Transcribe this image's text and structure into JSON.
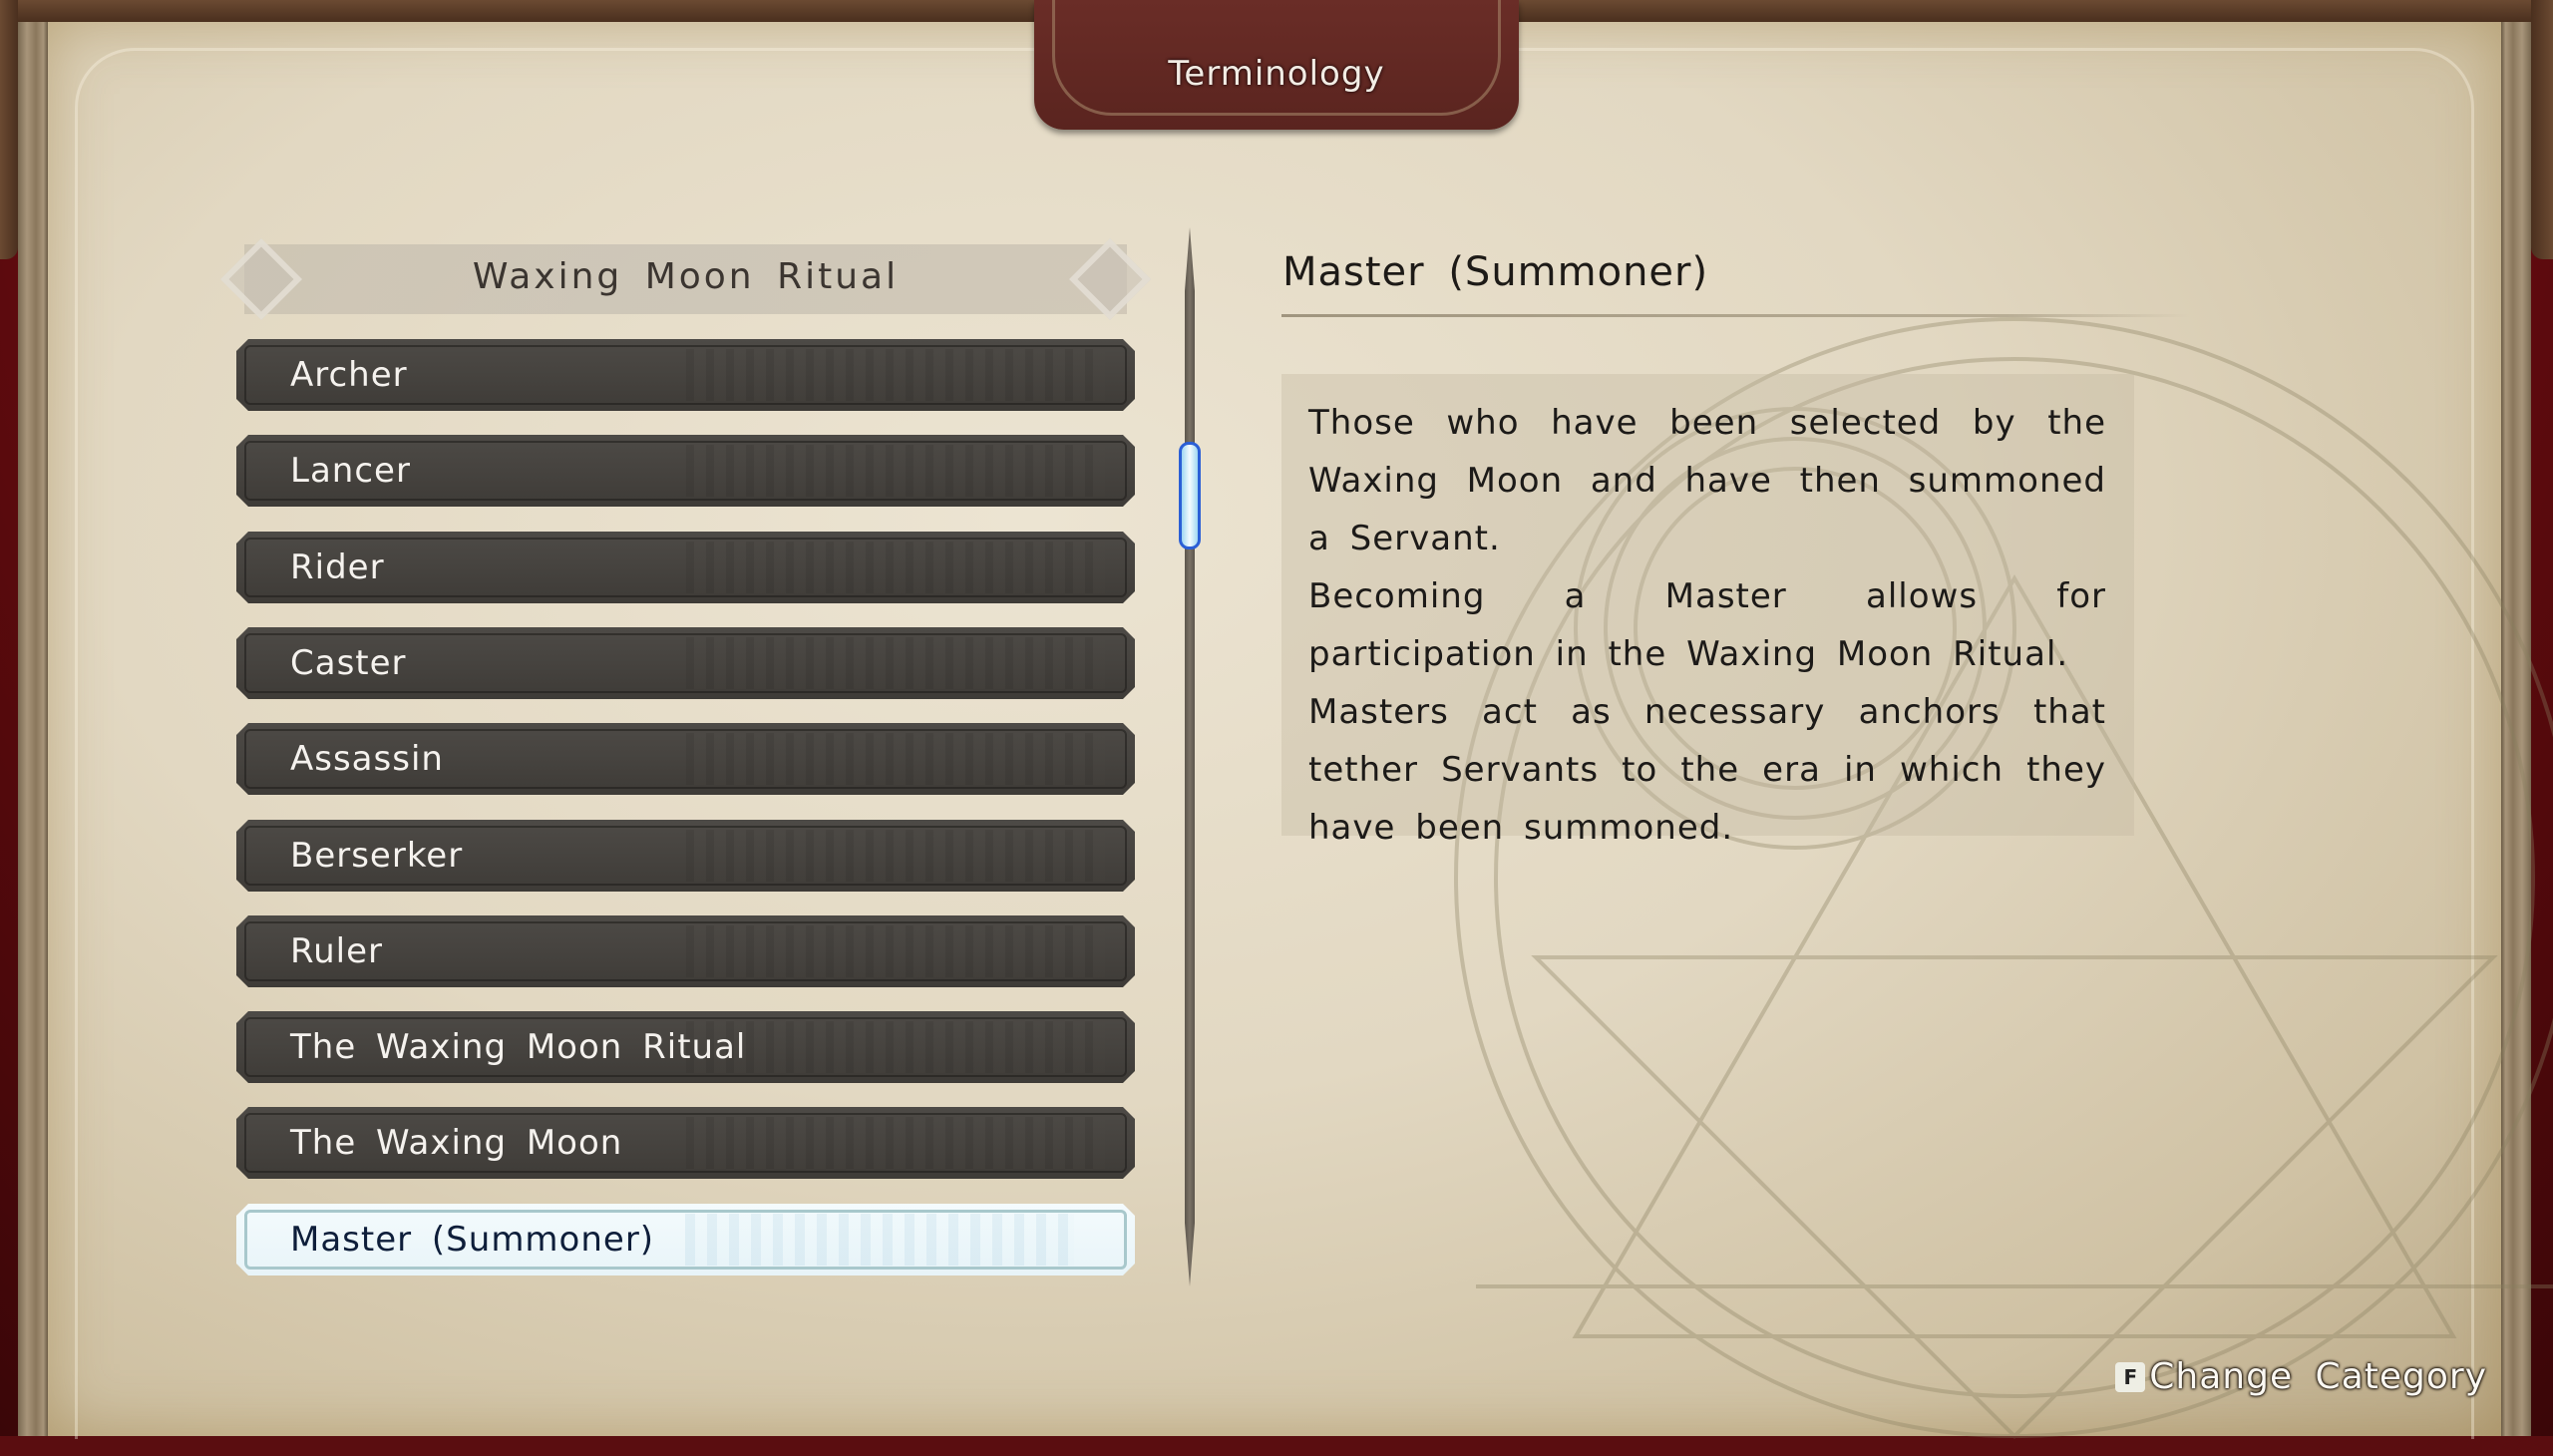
{
  "window": {
    "title": "Terminology"
  },
  "category": {
    "label": "Waxing Moon Ritual"
  },
  "list": {
    "items": [
      {
        "label": "Archer",
        "selected": false
      },
      {
        "label": "Lancer",
        "selected": false
      },
      {
        "label": "Rider",
        "selected": false
      },
      {
        "label": "Caster",
        "selected": false
      },
      {
        "label": "Assassin",
        "selected": false
      },
      {
        "label": "Berserker",
        "selected": false
      },
      {
        "label": "Ruler",
        "selected": false
      },
      {
        "label": "The Waxing Moon Ritual",
        "selected": false
      },
      {
        "label": "The Waxing Moon",
        "selected": false
      },
      {
        "label": "Master (Summoner)",
        "selected": true
      }
    ],
    "selected_index": 9
  },
  "detail": {
    "title": "Master (Summoner)",
    "paragraphs": [
      "Those who have been selected by the Waxing Moon and have then summoned a Servant.",
      "Becoming a Master allows for participation in the Waxing Moon Ritual.",
      "Masters act as necessary anchors that tether Servants to the era in which they have been summoned."
    ]
  },
  "footer": {
    "key": "F",
    "action_label": "Change Category"
  },
  "colors": {
    "frame_red": "#8b1218",
    "title_tab": "#5e2621",
    "item_dark": "#46433f",
    "item_selected": "#eef7fa",
    "scroll_thumb_border": "#2b5fd6"
  }
}
